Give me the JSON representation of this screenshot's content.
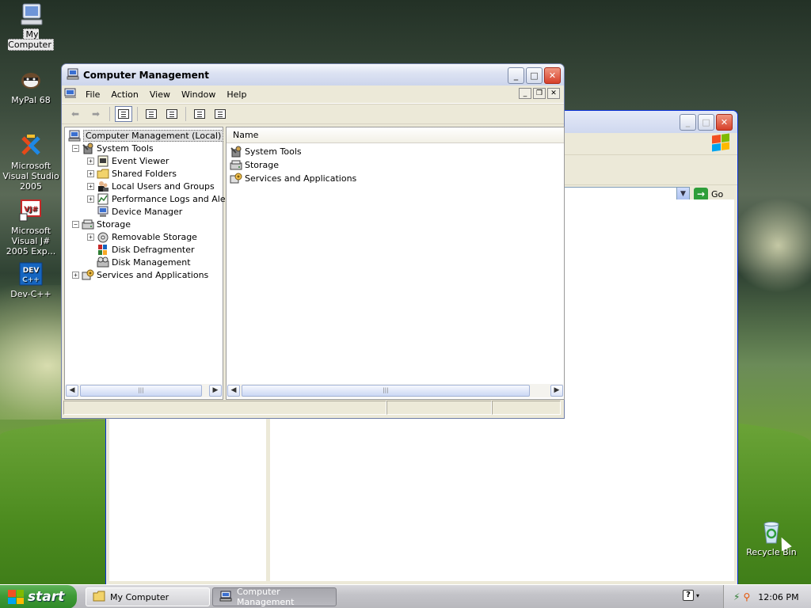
{
  "desktop": {
    "icons": [
      {
        "label": "My Computer"
      },
      {
        "label": "MyPal 68"
      },
      {
        "label": "Microsoft Visual Studio 2005"
      },
      {
        "label": "Microsoft Visual J# 2005 Exp..."
      },
      {
        "label": "Dev-C++"
      },
      {
        "label": "Recycle Bin"
      }
    ]
  },
  "back_window": {
    "go_label": "Go"
  },
  "main_window": {
    "title": "Computer Management",
    "menu": [
      "File",
      "Action",
      "View",
      "Window",
      "Help"
    ],
    "tree": [
      {
        "label": "Computer Management (Local)",
        "icon": "computer-icon"
      },
      {
        "label": "System Tools",
        "icon": "tools-icon"
      },
      {
        "label": "Event Viewer",
        "icon": "event-viewer-icon"
      },
      {
        "label": "Shared Folders",
        "icon": "folder-icon"
      },
      {
        "label": "Local Users and Groups",
        "icon": "users-icon"
      },
      {
        "label": "Performance Logs and Alerts",
        "icon": "performance-icon"
      },
      {
        "label": "Device Manager",
        "icon": "device-manager-icon"
      },
      {
        "label": "Storage",
        "icon": "storage-icon"
      },
      {
        "label": "Removable Storage",
        "icon": "removable-storage-icon"
      },
      {
        "label": "Disk Defragmenter",
        "icon": "defrag-icon"
      },
      {
        "label": "Disk Management",
        "icon": "disk-management-icon"
      },
      {
        "label": "Services and Applications",
        "icon": "services-icon"
      }
    ],
    "list_header": "Name",
    "list_items": [
      {
        "label": "System Tools"
      },
      {
        "label": "Storage"
      },
      {
        "label": "Services and Applications"
      }
    ]
  },
  "taskbar": {
    "start_label": "start",
    "tasks": [
      {
        "label": "My Computer"
      },
      {
        "label": "Computer Management"
      }
    ],
    "clock": "12:06 PM"
  },
  "colors": {
    "xp_blue_border": "#0831d9",
    "start_green": "#3e9a36",
    "close_red": "#d6402a"
  }
}
